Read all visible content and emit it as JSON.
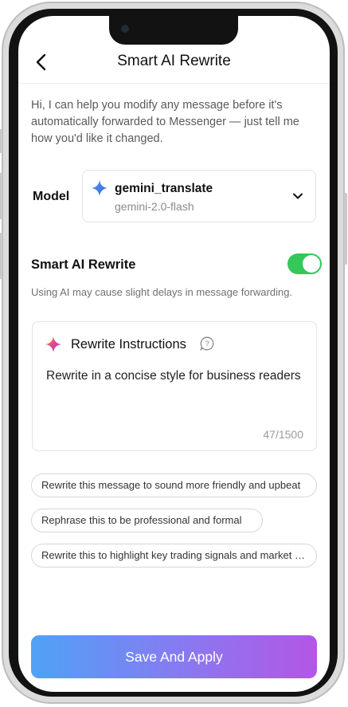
{
  "header": {
    "title": "Smart AI Rewrite",
    "back_icon": "chevron-left-icon"
  },
  "intro_text": "Hi, I can help you modify any message before it's automatically forwarded to Messenger — just tell me how you'd like it changed.",
  "model": {
    "label": "Model",
    "name": "gemini_translate",
    "version": "gemini-2.0-flash",
    "icon": "gemini-sparkle-icon"
  },
  "rewrite_toggle": {
    "label": "Smart AI Rewrite",
    "enabled": true,
    "note": "Using AI may cause slight delays in message forwarding."
  },
  "instructions": {
    "title": "Rewrite Instructions",
    "text": "Rewrite in a concise style for business readers",
    "counter": "47/1500"
  },
  "suggestions": [
    "Rewrite this message to sound more friendly and upbeat",
    "Rephrase this to be professional and formal",
    "Rewrite this to highlight key trading signals and market insights"
  ],
  "save_button": "Save And Apply",
  "colors": {
    "toggle_on": "#34c759",
    "button_gradient_start": "#4fa2f7",
    "button_gradient_end": "#b356e6"
  }
}
